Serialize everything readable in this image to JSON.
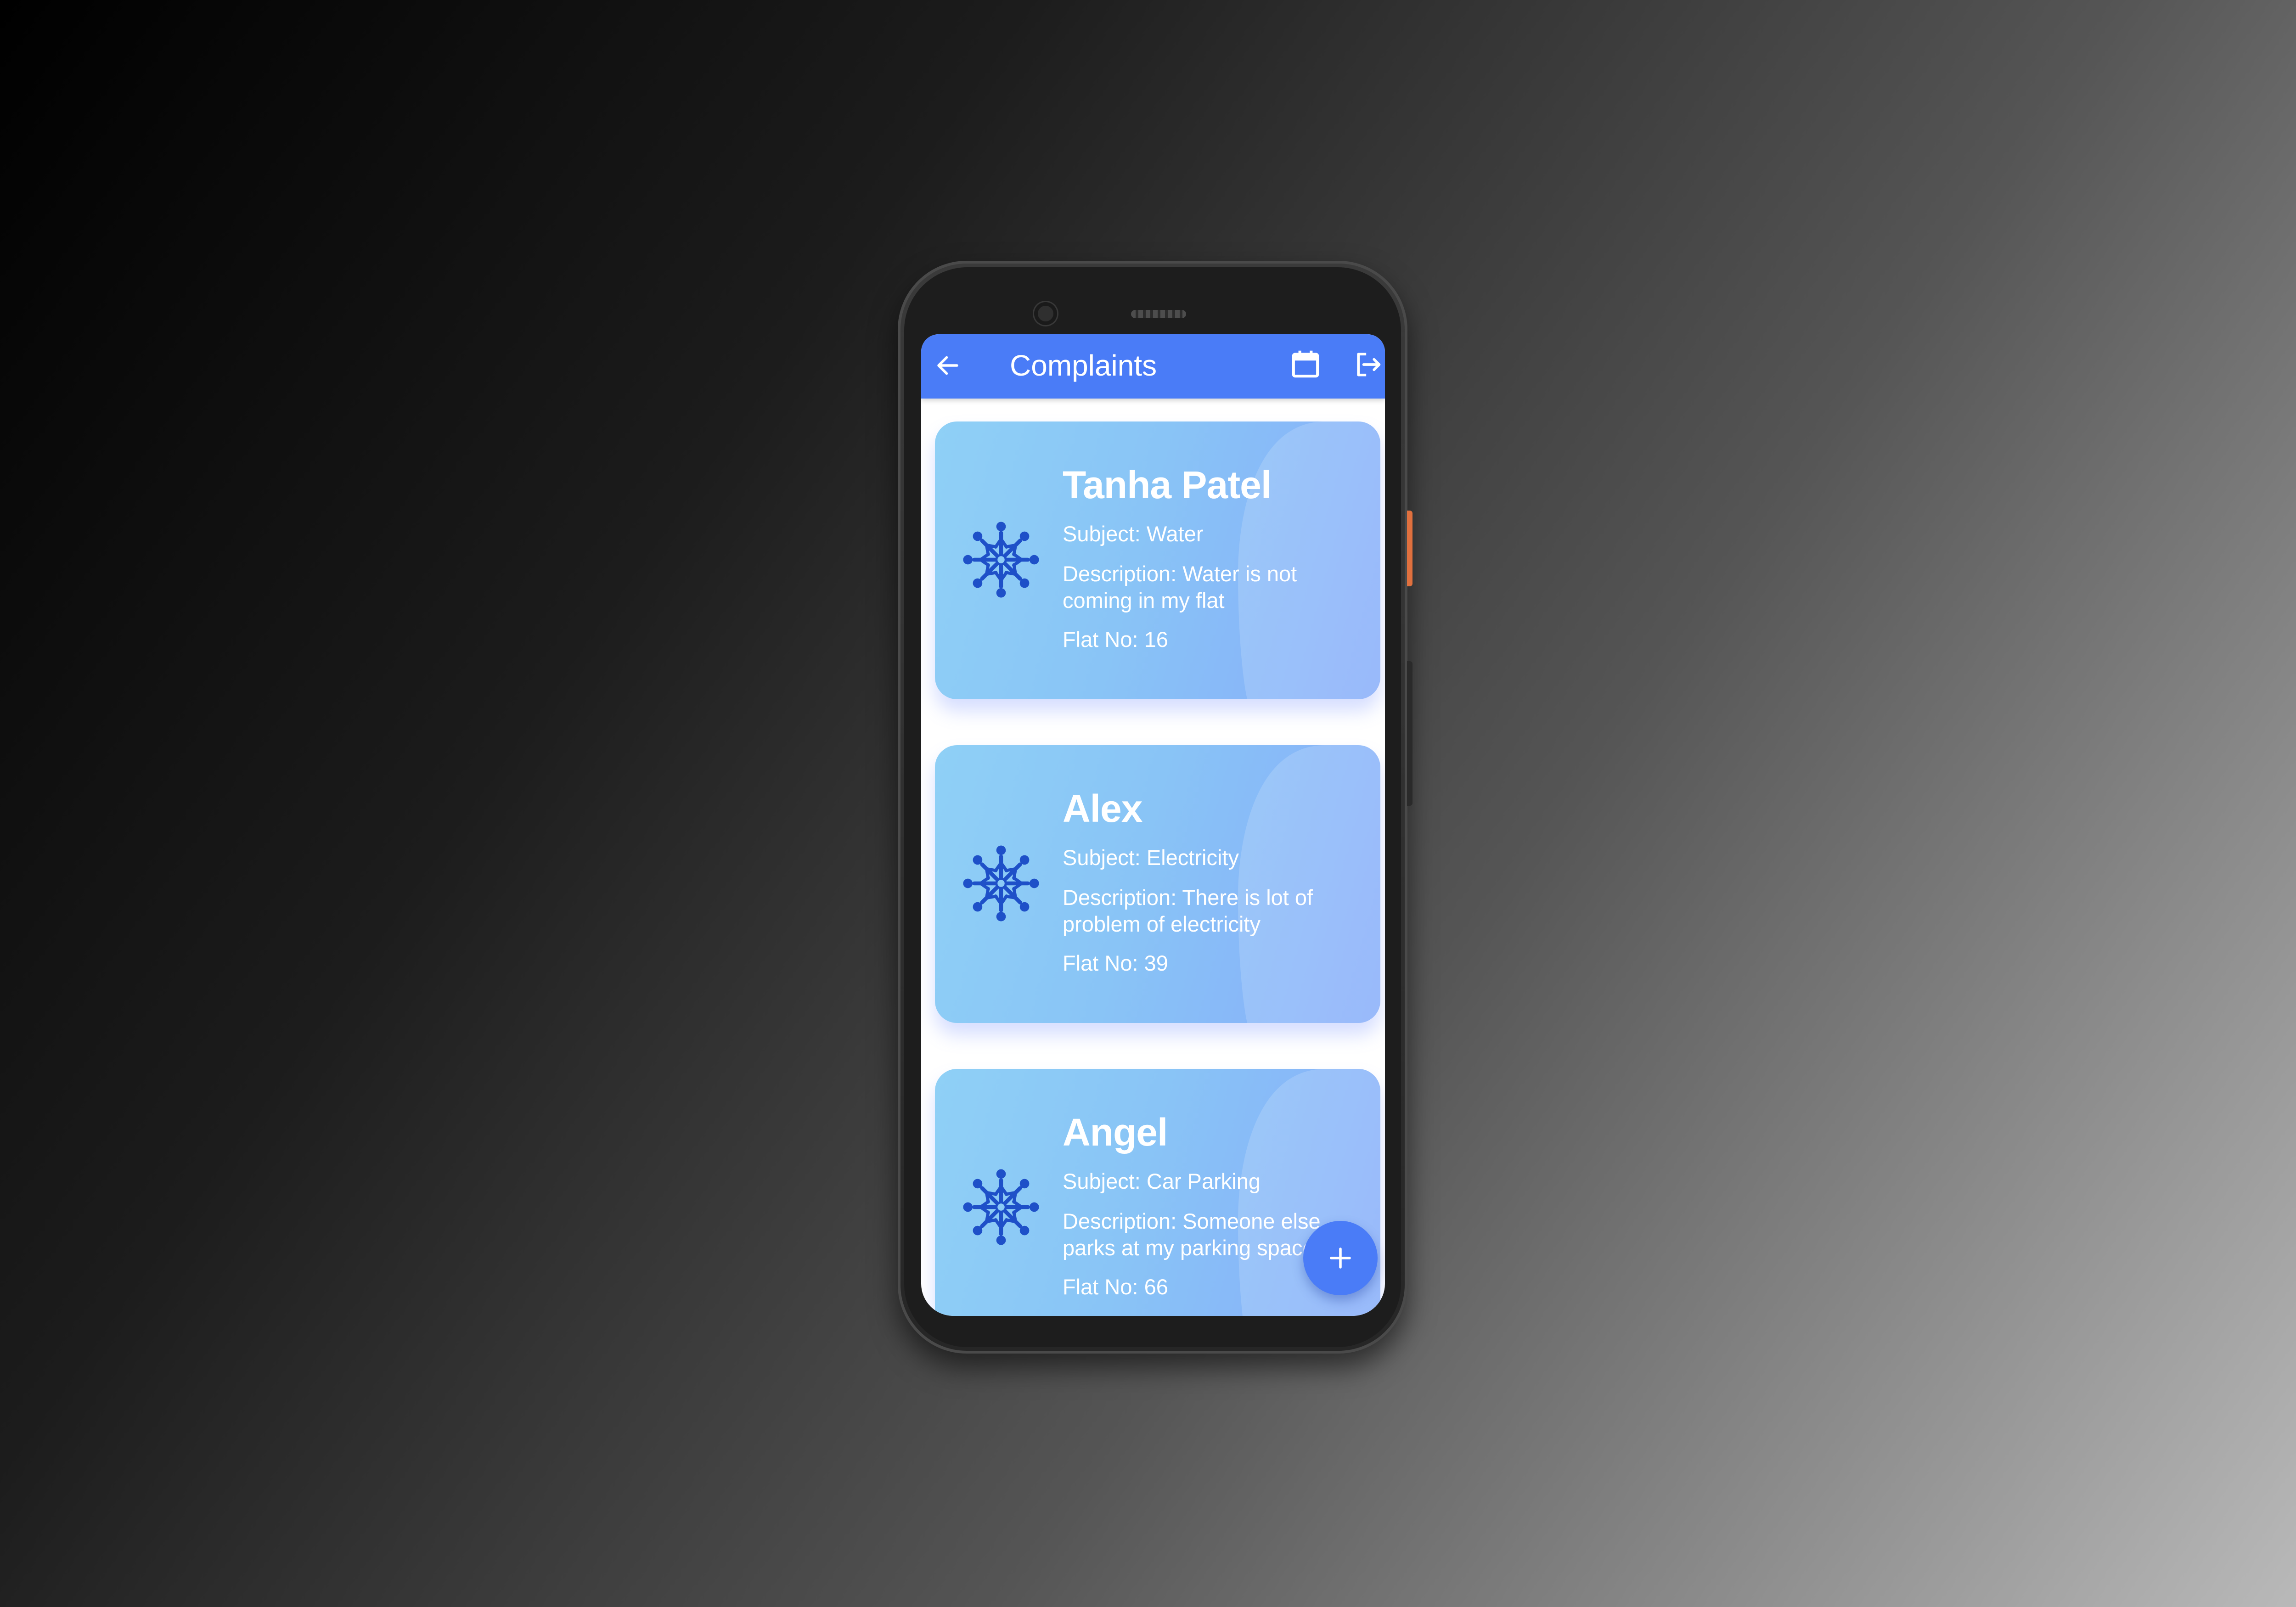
{
  "app": {
    "title": "Complaints"
  },
  "toolbar": {
    "back_icon": "arrow-left-icon",
    "calendar_icon": "calendar-icon",
    "logout_icon": "logout-icon"
  },
  "complaints": [
    {
      "name": "Tanha Patel",
      "subject": "Subject: Water",
      "description_line1": "Description: Water is not",
      "description_line2": "coming in my flat",
      "flat": "Flat No:  16"
    },
    {
      "name": "Alex",
      "subject": "Subject: Electricity",
      "description_line1": "Description: There is lot of",
      "description_line2": "problem of electricity",
      "flat": "Flat No:  39"
    },
    {
      "name": "Angel",
      "subject": "Subject: Car Parking",
      "description_line1": "Description: Someone else",
      "description_line2": "parks at my parking space",
      "flat": "Flat No:  66"
    }
  ],
  "fab": {
    "icon": "plus-icon"
  },
  "colors": {
    "primary": "#4a7cf7",
    "card_gradient_start": "#8fd0f6",
    "card_gradient_end": "#86acfa",
    "icon_color": "#1e50c8"
  }
}
